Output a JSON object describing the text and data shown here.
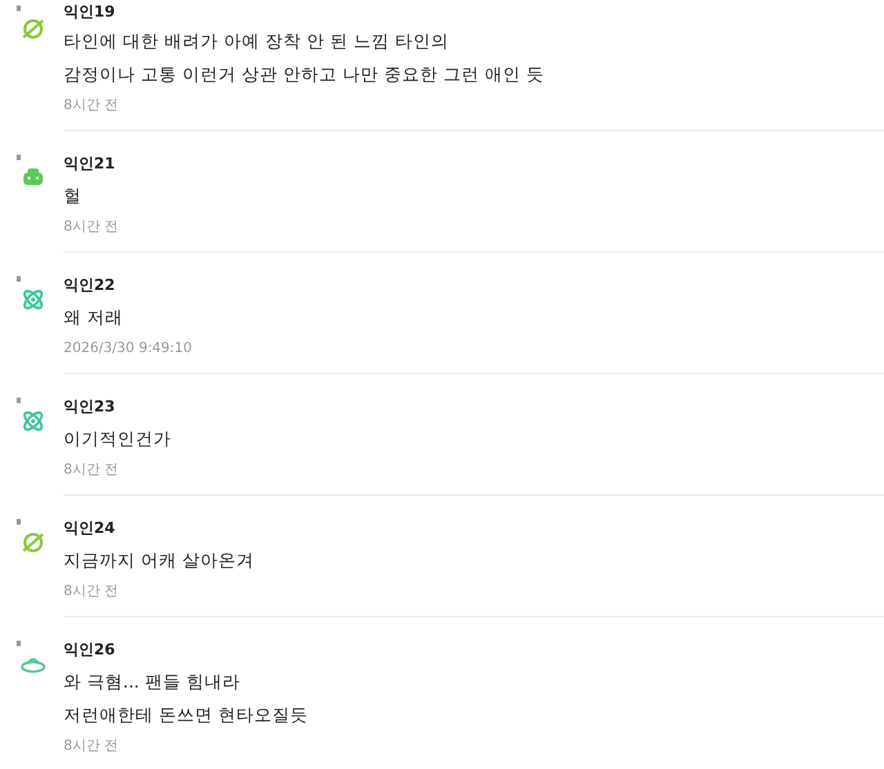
{
  "comments": [
    {
      "author": "익인19",
      "kind": "planet",
      "lines": [
        "타인에 대한 배려가 아예 장착 안 된 느낌 타인의",
        "감정이나 고통 이런거 상관 안하고 나만 중요한 그런 애인 듯"
      ],
      "time": "8시간 전"
    },
    {
      "author": "익인21",
      "kind": "robot",
      "lines": [
        "헐"
      ],
      "time": "8시간 전"
    },
    {
      "author": "익인22",
      "kind": "atom",
      "lines": [
        "왜 저래"
      ],
      "time": "2026/3/30 9:49:10"
    },
    {
      "author": "익인23",
      "kind": "atom",
      "lines": [
        "이기적인건가"
      ],
      "time": "8시간 전"
    },
    {
      "author": "익인24",
      "kind": "planet",
      "lines": [
        "지금까지 어캐 살아온겨"
      ],
      "time": "8시간 전"
    },
    {
      "author": "익인26",
      "kind": "ufo",
      "lines": [
        "와 극혐... 팬들 힘내라",
        "저런애한테 돈쓰면 현타오질듯"
      ],
      "time": "8시간 전"
    }
  ]
}
